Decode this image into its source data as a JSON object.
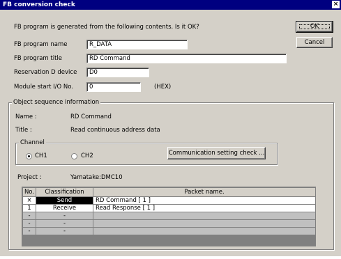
{
  "dialog": {
    "title": "FB conversion check",
    "close_glyph": "×",
    "prompt": "FB program is generated from the following contents. Is it OK?",
    "ok_label": "OK",
    "cancel_label": "Cancel"
  },
  "fields": {
    "program_name": {
      "label": "FB program name",
      "value": "R_DATA"
    },
    "program_title": {
      "label": "FB program title",
      "value": "RD Command"
    },
    "reservation": {
      "label": "Reservation D device",
      "value": "D0"
    },
    "module_start": {
      "label": "Module start I/O No.",
      "value": "0",
      "suffix": "(HEX)"
    }
  },
  "object_seq": {
    "group_label": "Object sequence information",
    "name_label": "Name :",
    "name_value": "RD Command",
    "title_label": "Title   :",
    "title_value": "Read continuous address data",
    "channel": {
      "group_label": "Channel",
      "ch1": "CH1",
      "ch2": "CH2",
      "selected": "CH1",
      "comm_button": "Communication setting check ..."
    },
    "project_label": "Project :",
    "project_value": "Yamatake:DMC10"
  },
  "table": {
    "headers": {
      "no": "No.",
      "classification": "Classification",
      "packet": "Packet name."
    },
    "rows": [
      {
        "no": "×",
        "classification": "Send",
        "packet": "RD Command [ 1 ]"
      },
      {
        "no": "1",
        "classification": "Receive",
        "packet": "Read Response [ 1 ]"
      },
      {
        "no": "-",
        "classification": "-",
        "packet": ""
      },
      {
        "no": "-",
        "classification": "-",
        "packet": ""
      },
      {
        "no": "-",
        "classification": "-",
        "packet": ""
      }
    ]
  },
  "colors": {
    "titlebar": "#000080",
    "face": "#d4d0c8",
    "selected_cell": "#000000"
  }
}
